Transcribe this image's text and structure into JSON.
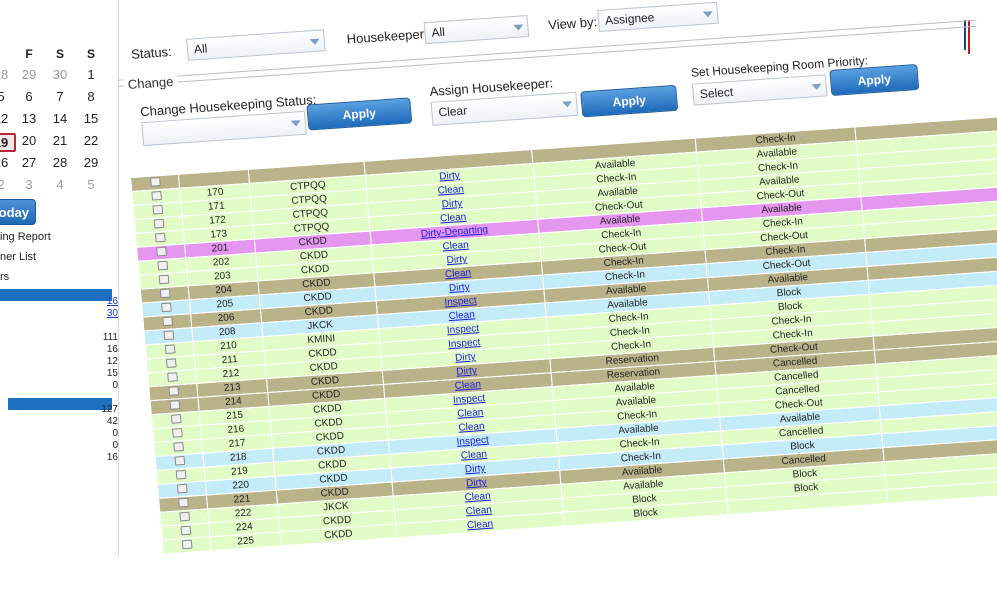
{
  "calendar": {
    "header": [
      "",
      "F",
      "S",
      "S"
    ],
    "rows": [
      [
        {
          "d": "28",
          "o": true
        },
        {
          "d": "29",
          "o": true
        },
        {
          "d": "30",
          "o": true
        },
        {
          "d": "1",
          "o": false
        }
      ],
      [
        {
          "d": "5",
          "o": false
        },
        {
          "d": "6",
          "o": false
        },
        {
          "d": "7",
          "o": false
        },
        {
          "d": "8",
          "o": false
        }
      ],
      [
        {
          "d": "12",
          "o": false
        },
        {
          "d": "13",
          "o": false
        },
        {
          "d": "14",
          "o": false
        },
        {
          "d": "15",
          "o": false
        }
      ],
      [
        {
          "d": "19",
          "o": false
        },
        {
          "d": "20",
          "o": false
        },
        {
          "d": "21",
          "o": false
        },
        {
          "d": "22",
          "o": false
        }
      ],
      [
        {
          "d": "26",
          "o": false
        },
        {
          "d": "27",
          "o": false
        },
        {
          "d": "28",
          "o": false
        },
        {
          "d": "29",
          "o": false
        }
      ],
      [
        {
          "d": "2",
          "o": true
        },
        {
          "d": "3",
          "o": true
        },
        {
          "d": "4",
          "o": true
        },
        {
          "d": "5",
          "o": true
        }
      ]
    ],
    "today_label": "oday"
  },
  "sidebar": {
    "links": [
      "ing Report",
      "ner List",
      "rs"
    ],
    "nums_top": [
      "16",
      "30"
    ],
    "nums_mid": [
      "111",
      "16",
      "12",
      "15",
      "0"
    ],
    "nums_bot": [
      "127",
      "42",
      "0",
      "0",
      "16"
    ]
  },
  "filters": {
    "status_label": "Status:",
    "status_value": "All",
    "housekeeper_label": "Housekeeper:",
    "housekeeper_value": "All",
    "viewby_label": "View by:",
    "viewby_value": "Assignee"
  },
  "change": {
    "legend": "Change",
    "status_label": "Change Housekeeping Status:",
    "status_value": "",
    "apply1": "Apply",
    "assign_label": "Assign Housekeeper:",
    "assign_value": "Clear",
    "apply2": "Apply",
    "priority_label": "Set Housekeeping Room Priority:",
    "priority_value": "Select",
    "apply3": "Apply"
  },
  "rows": [
    {
      "c": "olive",
      "room": "",
      "type": "",
      "status": "",
      "fo": "",
      "res": "Check-In"
    },
    {
      "c": "green",
      "room": "170",
      "type": "CTPQQ",
      "status": "Dirty",
      "fo": "Available",
      "res": "Available"
    },
    {
      "c": "green",
      "room": "171",
      "type": "CTPQQ",
      "status": "Clean",
      "fo": "Check-In",
      "res": "Check-In"
    },
    {
      "c": "green",
      "room": "172",
      "type": "CTPQQ",
      "status": "Dirty",
      "fo": "Available",
      "res": "Available"
    },
    {
      "c": "green",
      "room": "173",
      "type": "CTPQQ",
      "status": "Clean",
      "fo": "Check-Out",
      "res": "Check-Out"
    },
    {
      "c": "purple",
      "room": "201",
      "type": "CKDD",
      "status": "Dirty-Departing",
      "fo": "Available",
      "res": "Available"
    },
    {
      "c": "green",
      "room": "202",
      "type": "CKDD",
      "status": "Clean",
      "fo": "Check-In",
      "res": "Check-In"
    },
    {
      "c": "green",
      "room": "203",
      "type": "CKDD",
      "status": "Dirty",
      "fo": "Check-Out",
      "res": "Check-Out"
    },
    {
      "c": "olive",
      "room": "204",
      "type": "CKDD",
      "status": "Clean",
      "fo": "Check-In",
      "res": "Check-In"
    },
    {
      "c": "blue",
      "room": "205",
      "type": "CKDD",
      "status": "Dirty",
      "fo": "Check-In",
      "res": "Check-Out"
    },
    {
      "c": "olive",
      "room": "206",
      "type": "CKDD",
      "status": "Inspect",
      "fo": "Available",
      "res": "Available"
    },
    {
      "c": "blue",
      "room": "208",
      "type": "JKCK",
      "status": "Clean",
      "fo": "Available",
      "res": "Block"
    },
    {
      "c": "green",
      "room": "210",
      "type": "KMINI",
      "status": "Inspect",
      "fo": "Check-In",
      "res": "Block"
    },
    {
      "c": "green",
      "room": "211",
      "type": "CKDD",
      "status": "Inspect",
      "fo": "Check-In",
      "res": "Check-In"
    },
    {
      "c": "green",
      "room": "212",
      "type": "CKDD",
      "status": "Dirty",
      "fo": "Check-In",
      "res": "Check-In"
    },
    {
      "c": "olive",
      "room": "213",
      "type": "CKDD",
      "status": "Dirty",
      "fo": "Reservation",
      "res": "Check-Out"
    },
    {
      "c": "olive",
      "room": "214",
      "type": "CKDD",
      "status": "Clean",
      "fo": "Reservation",
      "res": "Cancelled"
    },
    {
      "c": "green",
      "room": "215",
      "type": "CKDD",
      "status": "Inspect",
      "fo": "Available",
      "res": "Cancelled"
    },
    {
      "c": "green",
      "room": "216",
      "type": "CKDD",
      "status": "Clean",
      "fo": "Available",
      "res": "Cancelled"
    },
    {
      "c": "green",
      "room": "217",
      "type": "CKDD",
      "status": "Clean",
      "fo": "Check-In",
      "res": "Check-Out"
    },
    {
      "c": "blue",
      "room": "218",
      "type": "CKDD",
      "status": "Inspect",
      "fo": "Available",
      "res": "Available"
    },
    {
      "c": "green",
      "room": "219",
      "type": "CKDD",
      "status": "Clean",
      "fo": "Check-In",
      "res": "Cancelled"
    },
    {
      "c": "blue",
      "room": "220",
      "type": "CKDD",
      "status": "Dirty",
      "fo": "Check-In",
      "res": "Block"
    },
    {
      "c": "olive",
      "room": "221",
      "type": "CKDD",
      "status": "Dirty",
      "fo": "Available",
      "res": "Cancelled"
    },
    {
      "c": "green",
      "room": "222",
      "type": "JKCK",
      "status": "Clean",
      "fo": "Available",
      "res": "Block"
    },
    {
      "c": "green",
      "room": "224",
      "type": "CKDD",
      "status": "Clean",
      "fo": "Block",
      "res": "Block"
    },
    {
      "c": "green",
      "room": "225",
      "type": "CKDD",
      "status": "Clean",
      "fo": "Block",
      "res": ""
    }
  ],
  "colors": {
    "olive": "#bab38a",
    "green": "#e2fcc8",
    "blue": "#c4ecf8",
    "purple": "#e596ef",
    "accent": "#1e6bbb"
  }
}
